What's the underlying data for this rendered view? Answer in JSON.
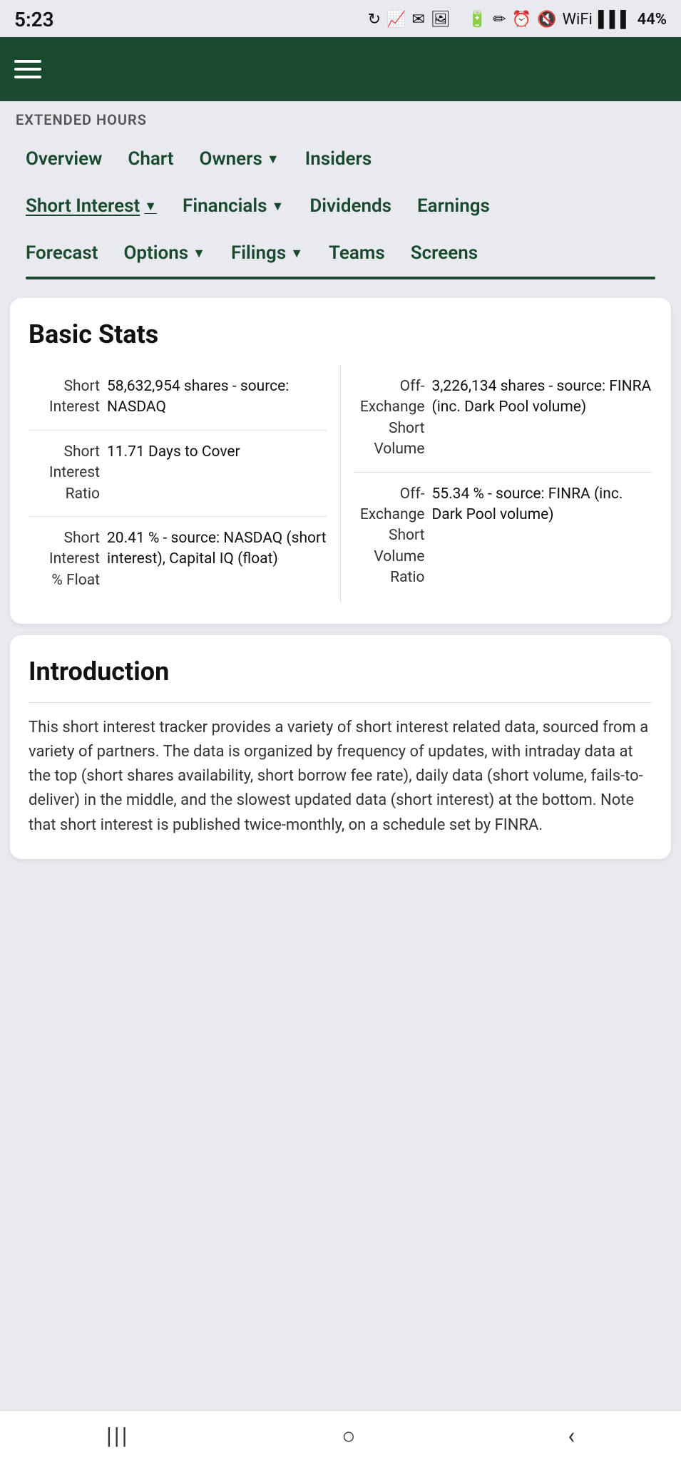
{
  "statusBar": {
    "time": "5:23",
    "battery": "44%"
  },
  "extendedHours": "EXTENDED HOURS",
  "nav": {
    "rows": [
      [
        {
          "label": "Overview",
          "hasArrow": false
        },
        {
          "label": "Chart",
          "hasArrow": false
        },
        {
          "label": "Owners",
          "hasArrow": true
        },
        {
          "label": "Insiders",
          "hasArrow": false
        }
      ],
      [
        {
          "label": "Short Interest",
          "hasArrow": true,
          "active": true
        },
        {
          "label": "Financials",
          "hasArrow": true
        },
        {
          "label": "Dividends",
          "hasArrow": false
        },
        {
          "label": "Earnings",
          "hasArrow": false
        }
      ],
      [
        {
          "label": "Forecast",
          "hasArrow": false
        },
        {
          "label": "Options",
          "hasArrow": true
        },
        {
          "label": "Filings",
          "hasArrow": true
        },
        {
          "label": "Teams",
          "hasArrow": false
        },
        {
          "label": "Screens",
          "hasArrow": false
        }
      ]
    ]
  },
  "basicStats": {
    "title": "Basic Stats",
    "leftStats": [
      {
        "label": "Short Interest",
        "value": "58,632,954 shares - source: NASDAQ"
      },
      {
        "label": "Short Interest Ratio",
        "value": "11.71 Days to Cover"
      },
      {
        "label": "Short Interest % Float",
        "value": "20.41 % - source: NASDAQ (short interest), Capital IQ (float)"
      }
    ],
    "rightStats": [
      {
        "label": "Off-Exchange Short Volume",
        "value": "3,226,134 shares - source: FINRA (inc. Dark Pool volume)"
      },
      {
        "label": "Off-Exchange Short Volume Ratio",
        "value": "55.34 % - source: FINRA (inc. Dark Pool volume)"
      }
    ]
  },
  "introduction": {
    "title": "Introduction",
    "text": "This short interest tracker provides a variety of short interest related data, sourced from a variety of partners. The data is organized by frequency of updates, with intraday data at the top (short shares availability, short borrow fee rate), daily data (short volume, fails-to-deliver) in the middle, and the slowest updated data (short interest) at the bottom. Note that short interest is published twice-monthly, on a schedule set by FINRA."
  },
  "bottomNav": {
    "items": [
      "|||",
      "○",
      "‹"
    ]
  }
}
